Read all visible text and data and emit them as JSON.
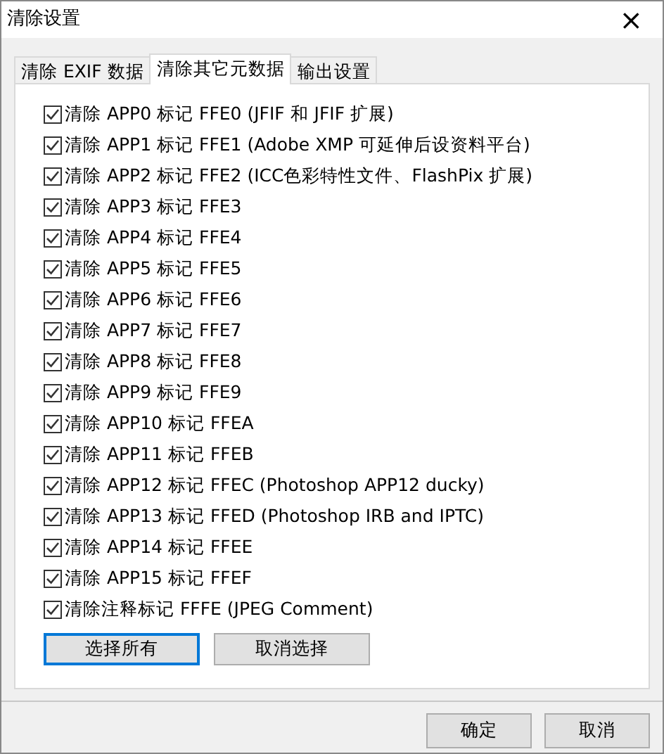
{
  "window": {
    "title": "清除设置",
    "close": "×"
  },
  "tabs": [
    {
      "label": "清除 EXIF 数据",
      "selected": false
    },
    {
      "label": "清除其它元数据",
      "selected": true
    },
    {
      "label": "输出设置",
      "selected": false
    }
  ],
  "options": [
    {
      "label": "清除 APP0 标记 FFE0 (JFIF 和 JFIF 扩展)",
      "checked": true
    },
    {
      "label": "清除 APP1 标记 FFE1 (Adobe XMP 可延伸后设资料平台)",
      "checked": true
    },
    {
      "label": "清除 APP2 标记 FFE2 (ICC色彩特性文件、FlashPix 扩展)",
      "checked": true
    },
    {
      "label": "清除 APP3 标记 FFE3",
      "checked": true
    },
    {
      "label": "清除 APP4 标记 FFE4",
      "checked": true
    },
    {
      "label": "清除 APP5 标记 FFE5",
      "checked": true
    },
    {
      "label": "清除 APP6 标记 FFE6",
      "checked": true
    },
    {
      "label": "清除 APP7 标记 FFE7",
      "checked": true
    },
    {
      "label": "清除 APP8 标记 FFE8",
      "checked": true
    },
    {
      "label": "清除 APP9 标记 FFE9",
      "checked": true
    },
    {
      "label": "清除 APP10 标记 FFEA",
      "checked": true
    },
    {
      "label": "清除 APP11 标记 FFEB",
      "checked": true
    },
    {
      "label": "清除 APP12 标记 FFEC (Photoshop APP12 ducky)",
      "checked": true
    },
    {
      "label": "清除 APP13 标记 FFED (Photoshop IRB and IPTC)",
      "checked": true
    },
    {
      "label": "清除 APP14 标记  FFEE",
      "checked": true
    },
    {
      "label": "清除 APP15 标记 FFEF",
      "checked": true
    },
    {
      "label": "清除注释标记 FFFE (JPEG Comment)",
      "checked": true
    }
  ],
  "panel_buttons": [
    {
      "label": "选择所有",
      "selected": true
    },
    {
      "label": "取消选择",
      "selected": false
    }
  ],
  "dialog_buttons": [
    {
      "label": "确定"
    },
    {
      "label": "取消"
    }
  ]
}
